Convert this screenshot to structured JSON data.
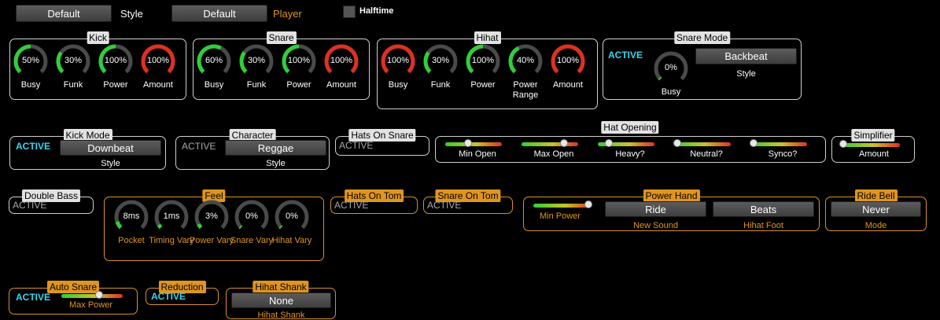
{
  "topbar": {
    "style_btn": "Default",
    "style_label": "Style",
    "player_btn": "Default",
    "player_label": "Player",
    "halftime_label": "Halftime"
  },
  "kick": {
    "title": "Kick",
    "knobs": [
      {
        "value": "50%",
        "label": "Busy",
        "level": 0.5,
        "color": "#2fcf3a"
      },
      {
        "value": "30%",
        "label": "Funk",
        "level": 0.3,
        "color": "#2fcf3a"
      },
      {
        "value": "100%",
        "label": "Power",
        "level": 0.5,
        "color": "#2fcf3a"
      },
      {
        "value": "100%",
        "label": "Amount",
        "level": 1.0,
        "color": "#e0301f"
      }
    ]
  },
  "snare": {
    "title": "Snare",
    "knobs": [
      {
        "value": "60%",
        "label": "Busy",
        "level": 0.6,
        "color": "#2fcf3a"
      },
      {
        "value": "30%",
        "label": "Funk",
        "level": 0.3,
        "color": "#2fcf3a"
      },
      {
        "value": "100%",
        "label": "Power",
        "level": 0.5,
        "color": "#2fcf3a"
      },
      {
        "value": "100%",
        "label": "Amount",
        "level": 1.0,
        "color": "#e0301f"
      }
    ]
  },
  "hihat": {
    "title": "Hihat",
    "knobs": [
      {
        "value": "100%",
        "label": "Busy",
        "level": 1.0,
        "color": "#e0301f"
      },
      {
        "value": "30%",
        "label": "Funk",
        "level": 0.3,
        "color": "#2fcf3a"
      },
      {
        "value": "100%",
        "label": "Power",
        "level": 0.5,
        "color": "#2fcf3a"
      },
      {
        "value": "40%",
        "label": "Power Range",
        "level": 0.4,
        "color": "#2fcf3a"
      },
      {
        "value": "100%",
        "label": "Amount",
        "level": 1.0,
        "color": "#e0301f"
      }
    ]
  },
  "snare_mode": {
    "title": "Snare Mode",
    "active": "ACTIVE",
    "knob_value": "0%",
    "knob_label": "Busy",
    "knob_level": 0.02,
    "btn": "Backbeat",
    "btn_sub": "Style"
  },
  "kick_mode": {
    "title": "Kick Mode",
    "active": "ACTIVE",
    "btn": "Downbeat",
    "sub": "Style"
  },
  "character": {
    "title": "Character",
    "active": "ACTIVE",
    "btn": "Reggae",
    "sub": "Style"
  },
  "hats_on_snare": {
    "title": "Hats On Snare",
    "active": "ACTIVE"
  },
  "hat_opening": {
    "title": "Hat Opening",
    "sliders": [
      {
        "label": "Min Open",
        "level": 0.4
      },
      {
        "label": "Max Open",
        "level": 0.75
      },
      {
        "label": "Heavy?",
        "level": 0.2
      },
      {
        "label": "Neutral?",
        "level": 0.05
      },
      {
        "label": "Synco?",
        "level": 0.05
      }
    ]
  },
  "simplifier": {
    "title": "Simplifier",
    "label": "Amount",
    "level": 0.05
  },
  "double_bass": {
    "title": "Double Bass",
    "active": "ACTIVE"
  },
  "feel": {
    "title": "Feel",
    "knobs": [
      {
        "value": "8ms",
        "label": "Pocket",
        "level": 0.1
      },
      {
        "value": "1ms",
        "label": "Timing Vary",
        "level": 0.05
      },
      {
        "value": "3%",
        "label": "Power Vary",
        "level": 0.06
      },
      {
        "value": "0%",
        "label": "Snare Vary",
        "level": 0.0
      },
      {
        "value": "0%",
        "label": "Hihat Vary",
        "level": 0.0
      }
    ]
  },
  "hats_on_tom": {
    "title": "Hats On Tom",
    "active": "ACTIVE"
  },
  "snare_on_tom": {
    "title": "Snare On Tom",
    "active": "ACTIVE"
  },
  "power_hand": {
    "title": "Power Hand",
    "slider_label": "Min Power",
    "slider_level": 0.95,
    "btn1": "Ride",
    "btn1_sub": "New Sound",
    "btn2": "Beats",
    "btn2_sub": "Hihat Foot"
  },
  "ride_bell": {
    "title": "Ride Bell",
    "btn": "Never",
    "sub": "Mode"
  },
  "auto_snare": {
    "title": "Auto Snare",
    "active": "ACTIVE",
    "slider_label": "Max Power",
    "slider_level": 0.62
  },
  "reduction": {
    "title": "Reduction",
    "active": "ACTIVE"
  },
  "hihat_shank": {
    "title": "Hihat Shank",
    "btn": "None",
    "sub": "Hihat Shank"
  },
  "colors": {
    "accent_orange": "#e0951f",
    "active_cyan": "#37d5ef",
    "green": "#2fcf3a",
    "red": "#e0301f"
  }
}
